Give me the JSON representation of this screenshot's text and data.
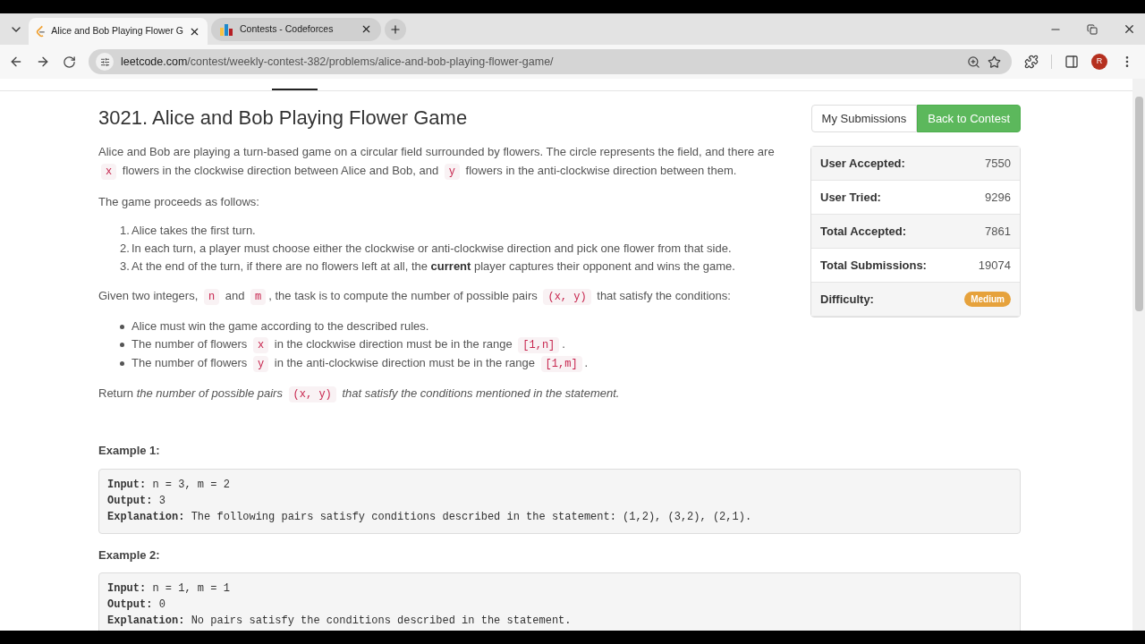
{
  "browser": {
    "tabs": [
      {
        "title": "Alice and Bob Playing Flower G",
        "selected": true
      },
      {
        "title": "Contests - Codeforces",
        "selected": false
      }
    ],
    "url_host": "leetcode.com",
    "url_path": "/contest/weekly-contest-382/problems/alice-and-bob-playing-flower-game/",
    "profile_initial": "R"
  },
  "problem": {
    "title": "3021. Alice and Bob Playing Flower Game",
    "paragraphs": [
      {
        "kind": "para",
        "segments": [
          {
            "kind": "text",
            "text": "Alice and Bob are playing a turn-based game on a circular field surrounded by flowers. The circle represents the field, and there are "
          },
          {
            "kind": "code",
            "text": "x"
          },
          {
            "kind": "text",
            "text": " flowers in the clockwise direction between Alice and Bob, and "
          },
          {
            "kind": "code",
            "text": "y"
          },
          {
            "kind": "text",
            "text": " flowers in the anti-clockwise direction between them."
          }
        ]
      },
      {
        "kind": "para",
        "segments": [
          {
            "kind": "text",
            "text": "The game proceeds as follows:"
          }
        ]
      },
      {
        "kind": "ordered",
        "items": [
          {
            "number": "1.",
            "segments": [
              {
                "kind": "text",
                "text": "Alice takes the first turn."
              }
            ]
          },
          {
            "number": "2.",
            "segments": [
              {
                "kind": "text",
                "text": "In each turn, a player must choose either the clockwise or anti-clockwise direction and pick one flower from that side."
              }
            ]
          },
          {
            "number": "3.",
            "segments": [
              {
                "kind": "text",
                "text": "At the end of the turn, if there are no flowers left at all, the "
              },
              {
                "kind": "bold",
                "text": "current"
              },
              {
                "kind": "text",
                "text": " player captures their opponent and wins the game."
              }
            ]
          }
        ]
      },
      {
        "kind": "para",
        "segments": [
          {
            "kind": "text",
            "text": "Given two integers, "
          },
          {
            "kind": "code",
            "text": "n"
          },
          {
            "kind": "text",
            "text": " and "
          },
          {
            "kind": "code",
            "text": "m"
          },
          {
            "kind": "text",
            "text": ", the task is to compute the number of possible pairs "
          },
          {
            "kind": "code",
            "text": "(x, y)"
          },
          {
            "kind": "text",
            "text": " that satisfy the conditions:"
          }
        ]
      },
      {
        "kind": "bullets",
        "items": [
          {
            "segments": [
              {
                "kind": "text",
                "text": "Alice must win the game according to the described rules."
              }
            ]
          },
          {
            "segments": [
              {
                "kind": "text",
                "text": "The number of flowers "
              },
              {
                "kind": "code",
                "text": "x"
              },
              {
                "kind": "text",
                "text": " in the clockwise direction must be in the range "
              },
              {
                "kind": "code",
                "text": "[1,n]"
              },
              {
                "kind": "text",
                "text": "."
              }
            ]
          },
          {
            "segments": [
              {
                "kind": "text",
                "text": "The number of flowers "
              },
              {
                "kind": "code",
                "text": "y"
              },
              {
                "kind": "text",
                "text": " in the anti-clockwise direction must be in the range "
              },
              {
                "kind": "code",
                "text": "[1,m]"
              },
              {
                "kind": "text",
                "text": "."
              }
            ]
          }
        ]
      },
      {
        "kind": "para",
        "segments": [
          {
            "kind": "text",
            "text": "Return "
          },
          {
            "kind": "italic",
            "text": "the number of possible pairs "
          },
          {
            "kind": "code",
            "text": "(x, y)"
          },
          {
            "kind": "italic",
            "text": " that satisfy the conditions mentioned in the statement."
          }
        ]
      }
    ],
    "examples": [
      {
        "heading": "Example 1:",
        "lines": [
          {
            "label": "Input:",
            "value": "n = 3, m = 2"
          },
          {
            "label": "Output:",
            "value": "3"
          },
          {
            "label": "Explanation:",
            "value": "The following pairs satisfy conditions described in the statement: (1,2), (3,2), (2,1)."
          }
        ]
      },
      {
        "heading": "Example 2:",
        "lines": [
          {
            "label": "Input:",
            "value": "n = 1, m = 1"
          },
          {
            "label": "Output:",
            "value": "0"
          },
          {
            "label": "Explanation:",
            "value": "No pairs satisfy the conditions described in the statement."
          }
        ]
      }
    ]
  },
  "sidebar": {
    "buttons": [
      {
        "label": "My Submissions",
        "primary": false
      },
      {
        "label": "Back to Contest",
        "primary": true
      }
    ],
    "stats": [
      {
        "label": "User Accepted:",
        "value": "7550"
      },
      {
        "label": "User Tried:",
        "value": "9296"
      },
      {
        "label": "Total Accepted:",
        "value": "7861"
      },
      {
        "label": "Total Submissions:",
        "value": "19074"
      },
      {
        "label": "Difficulty:",
        "badge": "Medium",
        "color": "#e6a23c"
      }
    ]
  }
}
